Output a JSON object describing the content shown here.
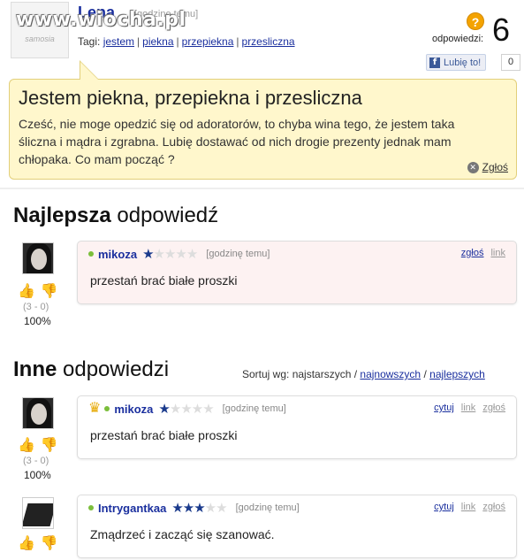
{
  "watermark": "www.wiocha.pl",
  "question": {
    "avatar_logo": "samosia",
    "author": "Lena",
    "time": "[godzinę temu]",
    "tags_label": "Tagi:",
    "tags": [
      "jestem",
      "piekna",
      "przepiekna",
      "przesliczna"
    ],
    "title": "Jestem piekna, przepiekna i przesliczna",
    "body": "Cześć, nie moge opedzić się od adoratorów, to chyba wina tego, że jestem taka śliczna i mądra i zgrabna. Lubię dostawać od nich drogie prezenty jednak mam chłopaka. Co mam począć ?",
    "report_label": "Zgłoś"
  },
  "answers_summary": {
    "icon": "question-mark-icon",
    "label": "odpowiedzi:",
    "count": "6"
  },
  "facebook": {
    "like_label": "Lubię to!",
    "like_count": "0"
  },
  "best_section": {
    "title_bold": "Najlepsza",
    "title_rest": " odpowiedź"
  },
  "other_section": {
    "title_bold": "Inne",
    "title_rest": " odpowiedzi",
    "sort_label": "Sortuj wg: najstarszych /",
    "sort_newest": "najnowszych",
    "sort_sep": "/",
    "sort_best": "najlepszych"
  },
  "best_answer": {
    "user": "mikoza",
    "stars": 1,
    "time": "[godzinę temu]",
    "report": "zgłoś",
    "link": "link",
    "text": "przestań brać białe proszki",
    "votes": "(3 - 0)",
    "percent": "100%"
  },
  "answers": [
    {
      "user": "mikoza",
      "stars": 1,
      "time": "[godzinę temu]",
      "quote": "cytuj",
      "link": "link",
      "report": "zgłoś",
      "text": "przestań brać białe proszki",
      "votes": "(3 - 0)",
      "percent": "100%"
    },
    {
      "user": "Intrygantkaa",
      "stars": 3,
      "time": "[godzinę temu]",
      "quote": "cytuj",
      "link": "link",
      "report": "zgłoś",
      "text": "Zmądrzeć i zacząć się szanować."
    }
  ],
  "colors": {
    "link_blue": "#1a2f9e",
    "bubble_bg": "#fff7cc",
    "best_card_bg": "#fdf2f2"
  }
}
